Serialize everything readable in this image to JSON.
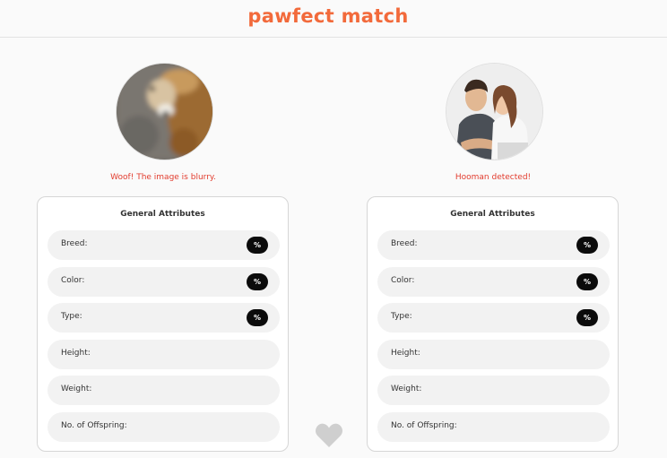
{
  "header": {
    "logo": "pawfect match"
  },
  "left": {
    "status": "Woof! The image is blurry.",
    "card_title": "General Attributes",
    "attributes": [
      {
        "label": "Breed:",
        "badge": "%"
      },
      {
        "label": "Color:",
        "badge": "%"
      },
      {
        "label": "Type:",
        "badge": "%"
      },
      {
        "label": "Height:"
      },
      {
        "label": "Weight:"
      },
      {
        "label": "No. of Offspring:"
      }
    ]
  },
  "right": {
    "status": "Hooman detected!",
    "card_title": "General Attributes",
    "attributes": [
      {
        "label": "Breed:",
        "badge": "%"
      },
      {
        "label": "Color:",
        "badge": "%"
      },
      {
        "label": "Type:",
        "badge": "%"
      },
      {
        "label": "Height:"
      },
      {
        "label": "Weight:"
      },
      {
        "label": "No. of Offspring:"
      }
    ]
  },
  "colors": {
    "brand": "#f26a3b",
    "status": "#e23c2e",
    "badge": "#0b0b0b",
    "heart": "#cfcfcf"
  },
  "icons": {
    "match": "heart-icon"
  }
}
